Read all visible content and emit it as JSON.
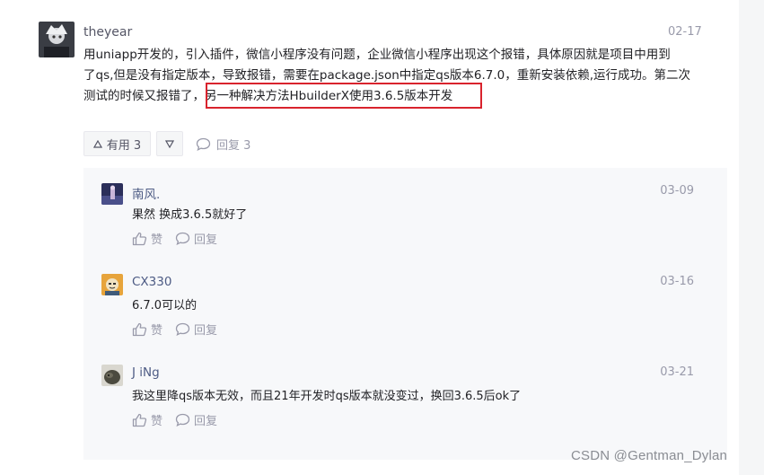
{
  "comment": {
    "username": "theyear",
    "date": "02-17",
    "text_line1": "用uniapp开发的，引入插件，微信小程序没有问题，企业微信小程序出现这个报错，具体原因就是项目中用到",
    "text_line2": "了qs,但是没有指定版本，导致报错，需要在package.json中指定qs版本6.7.0，重新安装依赖,运行成功。第二次",
    "text_line3_prefix": "测试的时候又报错了，",
    "text_line3_highlight": "另一种解决方法HbuilderX使用3.6.5版本开发",
    "useful_label": "有用 3",
    "reply_label": "回复 3"
  },
  "replies": [
    {
      "name": "南风.",
      "date": "03-09",
      "text": "果然 换成3.6.5就好了",
      "like_label": "赞",
      "reply_label": "回复"
    },
    {
      "name": "CX330",
      "date": "03-16",
      "text": "6.7.0可以的",
      "like_label": "赞",
      "reply_label": "回复"
    },
    {
      "name": "J iNg",
      "date": "03-21",
      "text": "我这里降qs版本无效，而且21年开发时qs版本就没变过，换回3.6.5后ok了",
      "like_label": "赞",
      "reply_label": "回复"
    }
  ],
  "watermark": "CSDN @Gentman_Dylan",
  "colors": {
    "highlight_border": "#d9232d",
    "reply_name": "#4d5b84",
    "muted": "#999aaa"
  }
}
